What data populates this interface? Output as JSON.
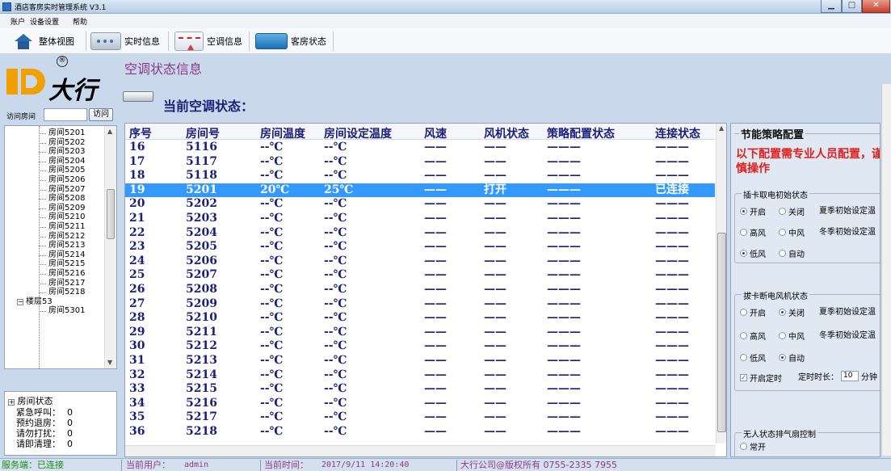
{
  "window": {
    "title": "酒店客房实时管理系统 V3.1"
  },
  "menu": [
    "账户",
    "设备设置",
    "帮助"
  ],
  "toolbar": {
    "overview": "整体视图",
    "realtime": "实时信息",
    "ac_info": "空调信息",
    "room_status": "客房状态"
  },
  "logo": {
    "text": "大行",
    "reg": "®"
  },
  "visit": {
    "label": "访问房间",
    "button": "访问",
    "value": ""
  },
  "tree": {
    "items": [
      {
        "label": "房间5201",
        "type": "room"
      },
      {
        "label": "房间5202",
        "type": "room"
      },
      {
        "label": "房间5203",
        "type": "room"
      },
      {
        "label": "房间5204",
        "type": "room"
      },
      {
        "label": "房间5205",
        "type": "room"
      },
      {
        "label": "房间5206",
        "type": "room"
      },
      {
        "label": "房间5207",
        "type": "room"
      },
      {
        "label": "房间5208",
        "type": "room"
      },
      {
        "label": "房间5209",
        "type": "room"
      },
      {
        "label": "房间5210",
        "type": "room"
      },
      {
        "label": "房间5211",
        "type": "room"
      },
      {
        "label": "房间5212",
        "type": "room"
      },
      {
        "label": "房间5213",
        "type": "room"
      },
      {
        "label": "房间5214",
        "type": "room"
      },
      {
        "label": "房间5215",
        "type": "room"
      },
      {
        "label": "房间5216",
        "type": "room"
      },
      {
        "label": "房间5217",
        "type": "room"
      },
      {
        "label": "房间5218",
        "type": "room"
      },
      {
        "label": "楼层53",
        "type": "floor",
        "expander": "−"
      },
      {
        "label": "房间5301",
        "type": "room"
      }
    ]
  },
  "room_status": {
    "title": "房间状态",
    "expander": "+",
    "rows": [
      {
        "label": "紧急呼叫：",
        "value": "0"
      },
      {
        "label": "预约退房：",
        "value": "0"
      },
      {
        "label": "请勿打扰：",
        "value": "0"
      },
      {
        "label": "请即清理：",
        "value": "0"
      }
    ]
  },
  "main": {
    "title": "空调状态信息",
    "section_title": "当前空调状态："
  },
  "table": {
    "columns": [
      "序号",
      "房间号",
      "房间温度",
      "房间设定温度",
      "风速",
      "风机状态",
      "策略配置状态",
      "连接状态"
    ],
    "selected_index": 3,
    "rows": [
      [
        "16",
        "5116",
        "--℃",
        "--℃",
        "——",
        "——",
        "———",
        "———"
      ],
      [
        "17",
        "5117",
        "--℃",
        "--℃",
        "——",
        "——",
        "———",
        "———"
      ],
      [
        "18",
        "5118",
        "--℃",
        "--℃",
        "——",
        "——",
        "———",
        "———"
      ],
      [
        "19",
        "5201",
        "20℃",
        "25℃",
        "——",
        "打开",
        "———",
        "已连接"
      ],
      [
        "20",
        "5202",
        "--℃",
        "--℃",
        "——",
        "——",
        "———",
        "———"
      ],
      [
        "21",
        "5203",
        "--℃",
        "--℃",
        "——",
        "——",
        "———",
        "———"
      ],
      [
        "22",
        "5204",
        "--℃",
        "--℃",
        "——",
        "——",
        "———",
        "———"
      ],
      [
        "23",
        "5205",
        "--℃",
        "--℃",
        "——",
        "——",
        "———",
        "———"
      ],
      [
        "24",
        "5206",
        "--℃",
        "--℃",
        "——",
        "——",
        "———",
        "———"
      ],
      [
        "25",
        "5207",
        "--℃",
        "--℃",
        "——",
        "——",
        "———",
        "———"
      ],
      [
        "26",
        "5208",
        "--℃",
        "--℃",
        "——",
        "——",
        "———",
        "———"
      ],
      [
        "27",
        "5209",
        "--℃",
        "--℃",
        "——",
        "——",
        "———",
        "———"
      ],
      [
        "28",
        "5210",
        "--℃",
        "--℃",
        "——",
        "——",
        "———",
        "———"
      ],
      [
        "29",
        "5211",
        "--℃",
        "--℃",
        "——",
        "——",
        "———",
        "———"
      ],
      [
        "30",
        "5212",
        "--℃",
        "--℃",
        "——",
        "——",
        "———",
        "———"
      ],
      [
        "31",
        "5213",
        "--℃",
        "--℃",
        "——",
        "——",
        "———",
        "———"
      ],
      [
        "32",
        "5214",
        "--℃",
        "--℃",
        "——",
        "——",
        "———",
        "———"
      ],
      [
        "33",
        "5215",
        "--℃",
        "--℃",
        "——",
        "——",
        "———",
        "———"
      ],
      [
        "34",
        "5216",
        "--℃",
        "--℃",
        "——",
        "——",
        "———",
        "———"
      ],
      [
        "35",
        "5217",
        "--℃",
        "--℃",
        "——",
        "——",
        "———",
        "———"
      ],
      [
        "36",
        "5218",
        "--℃",
        "--℃",
        "——",
        "——",
        "———",
        "———"
      ]
    ]
  },
  "config": {
    "title": "节能策略配置",
    "warning": "以下配置需专业人员配置，谨慎操作",
    "insert_card": {
      "title": "插卡取电初始状态",
      "power": {
        "on": "开启",
        "off": "关闭",
        "selected": "on"
      },
      "summer": "夏季初始设定温",
      "winter": "冬季初始设定温",
      "fan": {
        "high": "高风",
        "mid": "中风",
        "low": "低风",
        "auto": "自动",
        "selected": "low"
      }
    },
    "remove_card": {
      "title": "拔卡断电风机状态",
      "power": {
        "on": "开启",
        "off": "关闭",
        "selected": "off"
      },
      "summer": "夏季初始设定温",
      "winter": "冬季初始设定温",
      "fan": {
        "high": "高风",
        "mid": "中风",
        "low": "低风",
        "auto": "自动",
        "selected": "auto"
      },
      "timer_label": "开启定时",
      "timer_checked": true,
      "duration_label": "定时时长：",
      "duration_value": "10",
      "duration_unit": "分钟"
    },
    "exhaust": {
      "title": "无人状态排气扇控制",
      "option": "常开"
    }
  },
  "statusbar": {
    "server": "服务端：已连接",
    "user_label": "当前用户：",
    "user": "admin",
    "time_label": "当前时间：",
    "time": "2017/9/11 14:20:40",
    "copyright": "大行公司@版权所有 0755-2335 7955"
  },
  "colors": {
    "title_purple": "#8a3a8a",
    "header_navy": "#1b1f7a",
    "warning_red": "#e0201c",
    "selection_blue": "#3399ff",
    "status_green": "#1a8a1a"
  }
}
